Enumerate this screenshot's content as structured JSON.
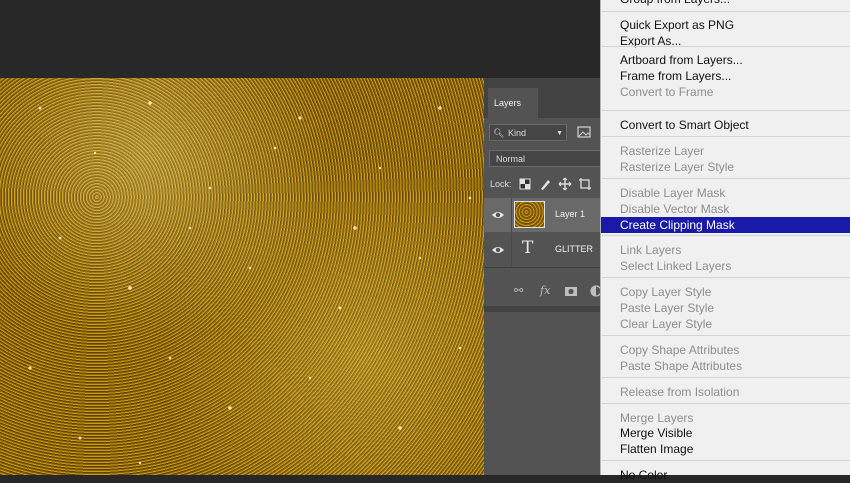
{
  "layers_panel": {
    "tab_label": "Layers",
    "filter": {
      "label": "Kind",
      "icon": "search-icon"
    },
    "blend_mode": "Normal",
    "lock_label": "Lock:",
    "layers": [
      {
        "name": "Layer 1",
        "visible": true,
        "thumbnail": "glitter-thumbnail",
        "selected": true
      },
      {
        "name": "GLITTER",
        "visible": true,
        "thumbnail": "text-layer-icon",
        "selected": false
      }
    ],
    "footer_fx_label": "fx"
  },
  "context_menu": {
    "items": [
      {
        "label": "Group from Layers...",
        "disabled": false
      },
      {
        "label": "Quick Export as PNG",
        "disabled": false
      },
      {
        "label": "Export As...",
        "disabled": false
      },
      {
        "label": "Artboard from Layers...",
        "disabled": false
      },
      {
        "label": "Frame from Layers...",
        "disabled": false
      },
      {
        "label": "Convert to Frame",
        "disabled": true
      },
      {
        "label": "Convert to Smart Object",
        "disabled": false
      },
      {
        "label": "Rasterize Layer",
        "disabled": true
      },
      {
        "label": "Rasterize Layer Style",
        "disabled": true
      },
      {
        "label": "Disable Layer Mask",
        "disabled": true
      },
      {
        "label": "Disable Vector Mask",
        "disabled": true
      },
      {
        "label": "Create Clipping Mask",
        "disabled": false,
        "highlighted": true
      },
      {
        "label": "Link Layers",
        "disabled": true
      },
      {
        "label": "Select Linked Layers",
        "disabled": true
      },
      {
        "label": "Copy Layer Style",
        "disabled": true
      },
      {
        "label": "Paste Layer Style",
        "disabled": true
      },
      {
        "label": "Clear Layer Style",
        "disabled": true
      },
      {
        "label": "Copy Shape Attributes",
        "disabled": true
      },
      {
        "label": "Paste Shape Attributes",
        "disabled": true
      },
      {
        "label": "Release from Isolation",
        "disabled": true
      },
      {
        "label": "Merge Layers",
        "disabled": true
      },
      {
        "label": "Merge Visible",
        "disabled": false
      },
      {
        "label": "Flatten Image",
        "disabled": false
      },
      {
        "label": "No Color",
        "disabled": false
      }
    ]
  },
  "colors": {
    "workspace": "#282828",
    "panel": "#535353",
    "selected_layer": "#696969",
    "menu_background": "#f0f0f0",
    "menu_highlight": "#1a1aa8",
    "glitter_gold": "#c99a14"
  }
}
